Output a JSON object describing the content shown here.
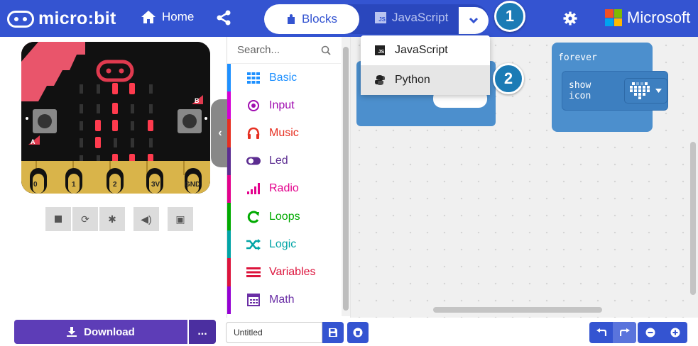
{
  "header": {
    "brand": "micro:bit",
    "home_label": "Home",
    "blocks_label": "Blocks",
    "javascript_label": "JavaScript",
    "js_badge": "JS",
    "microsoft_label": "Microsoft",
    "ms_colors": [
      "#f25022",
      "#7fba00",
      "#00a4ef",
      "#ffb900"
    ]
  },
  "callouts": [
    "1",
    "2"
  ],
  "language_menu": {
    "items": [
      {
        "label": "JavaScript",
        "icon": "javascript-icon",
        "highlighted": false
      },
      {
        "label": "Python",
        "icon": "python-icon",
        "highlighted": true
      }
    ]
  },
  "simulator": {
    "pins": [
      "0",
      "1",
      "2",
      "3V",
      "GND"
    ],
    "button_a": "A",
    "button_b": "B",
    "controls": [
      "stop-icon",
      "restart-icon",
      "debug-icon",
      "mute-icon",
      "fullscreen-icon"
    ]
  },
  "toolbox": {
    "search_placeholder": "Search...",
    "categories": [
      {
        "label": "Basic",
        "color": "#1e90ff"
      },
      {
        "label": "Input",
        "color": "#d400d4"
      },
      {
        "label": "Music",
        "color": "#e63022"
      },
      {
        "label": "Led",
        "color": "#5c2d91"
      },
      {
        "label": "Radio",
        "color": "#e3008c"
      },
      {
        "label": "Loops",
        "color": "#00aa00"
      },
      {
        "label": "Logic",
        "color": "#00a4a6"
      },
      {
        "label": "Variables",
        "color": "#dc143c"
      },
      {
        "label": "Math",
        "color": "#9400d3"
      }
    ]
  },
  "workspace": {
    "forever_label": "forever",
    "show_icon_label": "show icon",
    "block_color": "#4c8fcd"
  },
  "footer": {
    "download_label": "Download",
    "more_label": "...",
    "project_name": "Untitled"
  }
}
